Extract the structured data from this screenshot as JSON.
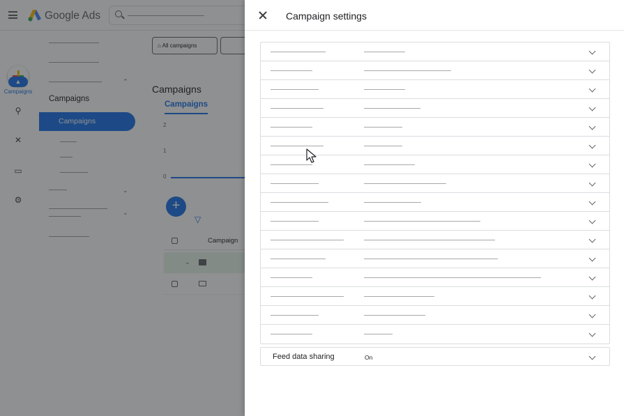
{
  "app": {
    "product_name": "Google Ads",
    "rail": {
      "campaigns_label": "Campaigns"
    },
    "nav": {
      "campaigns_heading": "Campaigns",
      "active_item": "Campaigns"
    },
    "main": {
      "filter_all_campaigns": "All campaigns",
      "page_heading": "Campaigns",
      "active_tab": "Campaigns",
      "y_ticks": [
        "2",
        "1",
        "0"
      ],
      "table_column": "Campaign"
    }
  },
  "panel": {
    "title": "Campaign settings",
    "feed_row": {
      "name": "Feed data sharing",
      "value": "On"
    }
  }
}
